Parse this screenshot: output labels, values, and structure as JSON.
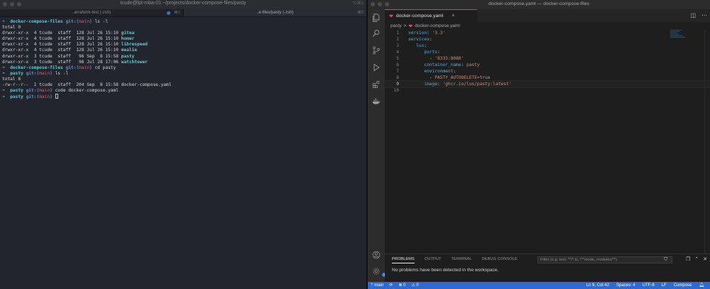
{
  "terminal": {
    "title": "tcude@lpt-mba-01:~/projects/docker-compose-files/pasty",
    "title_kbd": "⌥⌘1",
    "tabs": [
      {
        "label": "..erraform-test (-zsh)",
        "kbd": "⌘1",
        "has_dot": true
      },
      {
        "label": "..e-files/pasty (-zsh)",
        "kbd": "⌘2",
        "has_dot": false
      }
    ],
    "lines": {
      "l1": {
        "arrow": "➜",
        "dir": "docker-compose-files",
        "git": "git:(",
        "branch": "main",
        "git_end": ")",
        "cmd": " ls -l"
      },
      "l2": "total 0",
      "rows1": [
        {
          "meta": "drwxr-xr-x  4 tcude  staff  128 Jul 26 15:10 ",
          "name": "gitea"
        },
        {
          "meta": "drwxr-xr-x  4 tcude  staff  128 Jul 26 15:10 ",
          "name": "homer"
        },
        {
          "meta": "drwxr-xr-x  4 tcude  staff  128 Jul 26 15:10 ",
          "name": "librespeed"
        },
        {
          "meta": "drwxr-xr-x  4 tcude  staff  128 Jul 26 15:10 ",
          "name": "mealie"
        },
        {
          "meta": "drwxr-xr-x  3 tcude  staff   96 Sep  8 15:58 ",
          "name": "pasty"
        },
        {
          "meta": "drwxr-xr-x  3 tcude  staff   96 Jul 28 17:06 ",
          "name": "watchtower"
        }
      ],
      "l9": {
        "arrow": "➜",
        "dir": "docker-compose-files",
        "git": "git:(",
        "branch": "main",
        "git_end": ")",
        "cmd": " cd pasty"
      },
      "l10": {
        "arrow": "➜",
        "dir": "pasty",
        "git": "git:(",
        "branch": "main",
        "git_end": ")",
        "cmd": " ls -l"
      },
      "l11": "total 8",
      "l12": "-rw-r--r--  1 tcude  staff  204 Sep  8 15:58 docker-compose.yaml",
      "l13": {
        "arrow": "➜",
        "dir": "pasty",
        "git": "git:(",
        "branch": "main",
        "git_end": ")",
        "cmd": " code docker-compose.yaml"
      },
      "l14": {
        "arrow": "➜",
        "dir": "pasty",
        "git": "git:(",
        "branch": "main",
        "git_end": ")",
        "cmd": " "
      }
    }
  },
  "vscode": {
    "title": "docker-compose.yaml — docker-compose-files",
    "tab_label": "docker-compose.yaml",
    "tab_close": "×",
    "breadcrumb": {
      "folder": "pasty",
      "sep": ">",
      "file": "docker-compose.yaml"
    },
    "code_lines": [
      {
        "n": "1",
        "indent": "",
        "key": "version",
        "rest": ": ",
        "str": "'3.3'"
      },
      {
        "n": "2",
        "indent": "",
        "key": "services",
        "rest": ":",
        "str": ""
      },
      {
        "n": "3",
        "indent": "   ",
        "key": "lus",
        "rest": ":",
        "str": ""
      },
      {
        "n": "4",
        "indent": "      ",
        "key": "ports",
        "rest": ":",
        "str": ""
      },
      {
        "n": "5",
        "indent": "        ",
        "key": "",
        "rest": "- ",
        "str": "'8333:8080'"
      },
      {
        "n": "6",
        "indent": "      ",
        "key": "container_name",
        "rest": ": ",
        "str": "pasty"
      },
      {
        "n": "7",
        "indent": "      ",
        "key": "environment",
        "rest": ":",
        "str": ""
      },
      {
        "n": "8",
        "indent": "        ",
        "key": "",
        "rest": "- ",
        "str": "PASTY_AUTODELETE=true"
      },
      {
        "n": "9",
        "indent": "      ",
        "key": "image",
        "rest": ": ",
        "str": "'ghcr.io/lus/pasty:latest'"
      },
      {
        "n": "10",
        "indent": "",
        "key": "",
        "rest": "",
        "str": ""
      }
    ],
    "current_line": "9",
    "panel": {
      "tabs": [
        "PROBLEMS",
        "OUTPUT",
        "TERMINAL",
        "DEBUG CONSOLE"
      ],
      "active_tab": "PROBLEMS",
      "filter_placeholder": "Filter (e.g. text, **/*.ts, !**/node_modules/**)",
      "message": "No problems have been detected in the workspace."
    },
    "status": {
      "branch": "main",
      "sync": "⟳",
      "errors": "⊗ 0",
      "warnings": "⚠ 0",
      "position": "Ln 9, Col 42",
      "spaces": "Spaces: 4",
      "encoding": "UTF-8",
      "eol": "LF",
      "language": "Compose"
    },
    "account_badge": "1",
    "colors": {
      "accent": "#2f6ad0",
      "yaml_key": "#5fa8d8",
      "yaml_string": "#ce9178"
    }
  }
}
